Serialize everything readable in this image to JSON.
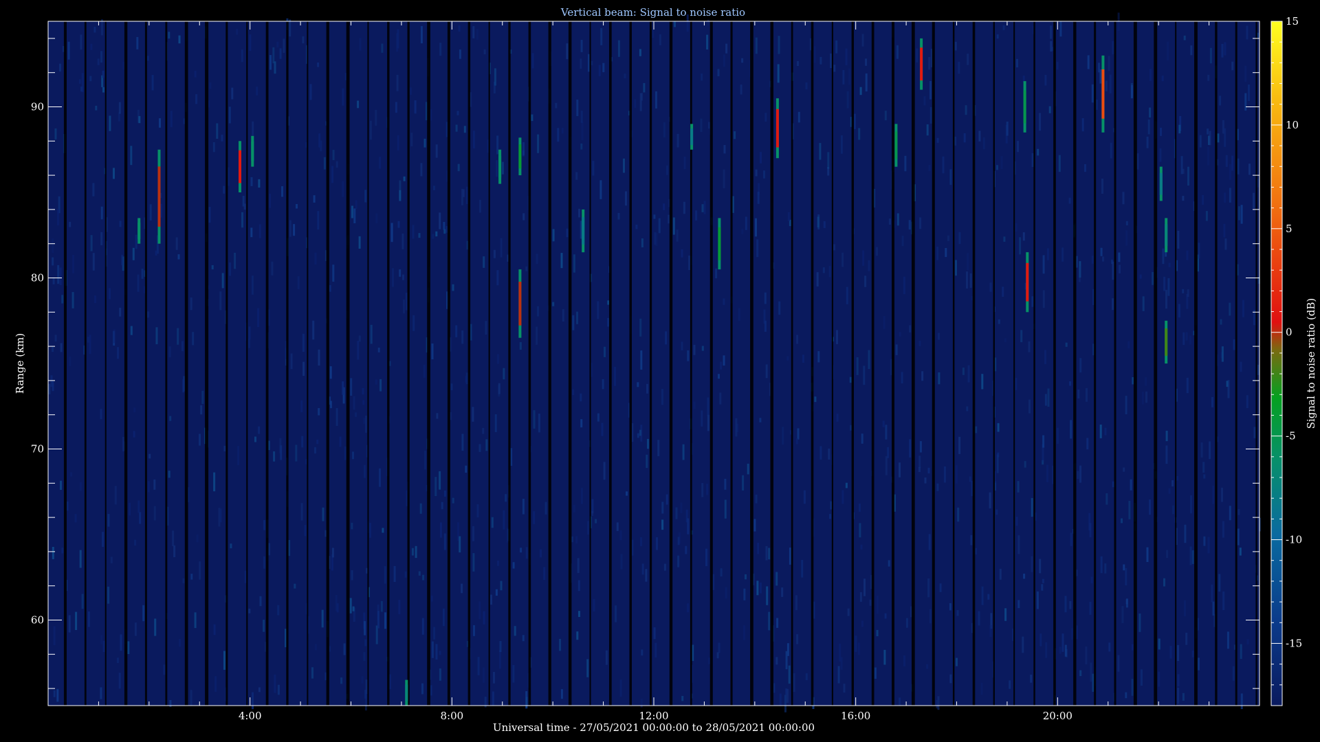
{
  "chart_data": {
    "type": "heatmap",
    "title": "Vertical beam: Signal to noise ratio",
    "xlabel": "Universal time - 27/05/2021 00:00:00 to 28/05/2021 00:00:00",
    "ylabel": "Range (km)",
    "colorbar_label": "Signal to noise ratio (dB)",
    "x_range_hours": [
      0,
      24
    ],
    "y_range_km": [
      55,
      95
    ],
    "x_ticks": [
      {
        "value": 4,
        "label": "4:00"
      },
      {
        "value": 8,
        "label": "8:00"
      },
      {
        "value": 12,
        "label": "12:00"
      },
      {
        "value": 16,
        "label": "16:00"
      },
      {
        "value": 20,
        "label": "20:00"
      }
    ],
    "y_ticks": [
      {
        "value": 60,
        "label": "60"
      },
      {
        "value": 70,
        "label": "70"
      },
      {
        "value": 80,
        "label": "80"
      },
      {
        "value": 90,
        "label": "90"
      }
    ],
    "colorbar_range_db": [
      -18,
      15
    ],
    "colorbar_ticks": [
      {
        "value": 15,
        "label": "15"
      },
      {
        "value": 10,
        "label": "10"
      },
      {
        "value": 5,
        "label": "5"
      },
      {
        "value": 0,
        "label": "0"
      },
      {
        "value": -5,
        "label": "-5"
      },
      {
        "value": -10,
        "label": "-10"
      },
      {
        "value": -15,
        "label": "-15"
      }
    ],
    "background_snr_db": -15,
    "colors": {
      "background": "#0a1a5e",
      "axes": "#ffffff",
      "title": "#9fc7ff"
    },
    "echoes": [
      {
        "time_h": 1.8,
        "range_bottom_km": 82,
        "range_top_km": 83.5,
        "snr_db": -6
      },
      {
        "time_h": 2.2,
        "range_bottom_km": 82,
        "range_top_km": 87.5,
        "snr_db": 0
      },
      {
        "time_h": 3.8,
        "range_bottom_km": 85,
        "range_top_km": 88,
        "snr_db": 1
      },
      {
        "time_h": 4.05,
        "range_bottom_km": 86.5,
        "range_top_km": 88.3,
        "snr_db": -6
      },
      {
        "time_h": 7.1,
        "range_bottom_km": 55,
        "range_top_km": 56.5,
        "snr_db": -7
      },
      {
        "time_h": 8.95,
        "range_bottom_km": 85.5,
        "range_top_km": 87.5,
        "snr_db": -6
      },
      {
        "time_h": 9.35,
        "range_bottom_km": 86,
        "range_top_km": 88.2,
        "snr_db": -4
      },
      {
        "time_h": 9.35,
        "range_bottom_km": 76.5,
        "range_top_km": 80.5,
        "snr_db": 0
      },
      {
        "time_h": 10.6,
        "range_bottom_km": 81.5,
        "range_top_km": 84,
        "snr_db": -8
      },
      {
        "time_h": 12.75,
        "range_bottom_km": 87.5,
        "range_top_km": 89,
        "snr_db": -8
      },
      {
        "time_h": 13.3,
        "range_bottom_km": 80.5,
        "range_top_km": 83.5,
        "snr_db": -4
      },
      {
        "time_h": 14.45,
        "range_bottom_km": 87,
        "range_top_km": 90.5,
        "snr_db": 1
      },
      {
        "time_h": 16.8,
        "range_bottom_km": 86.5,
        "range_top_km": 89,
        "snr_db": -5
      },
      {
        "time_h": 17.3,
        "range_bottom_km": 91,
        "range_top_km": 94,
        "snr_db": 1
      },
      {
        "time_h": 19.35,
        "range_bottom_km": 88.5,
        "range_top_km": 91.5,
        "snr_db": -5
      },
      {
        "time_h": 19.4,
        "range_bottom_km": 78,
        "range_top_km": 81.5,
        "snr_db": 1
      },
      {
        "time_h": 20.9,
        "range_bottom_km": 88.5,
        "range_top_km": 93,
        "snr_db": 4
      },
      {
        "time_h": 22.05,
        "range_bottom_km": 84.5,
        "range_top_km": 86.5,
        "snr_db": -8
      },
      {
        "time_h": 22.15,
        "range_bottom_km": 81.5,
        "range_top_km": 83.5,
        "snr_db": -7
      },
      {
        "time_h": 22.15,
        "range_bottom_km": 75,
        "range_top_km": 77.5,
        "snr_db": -2
      }
    ]
  }
}
